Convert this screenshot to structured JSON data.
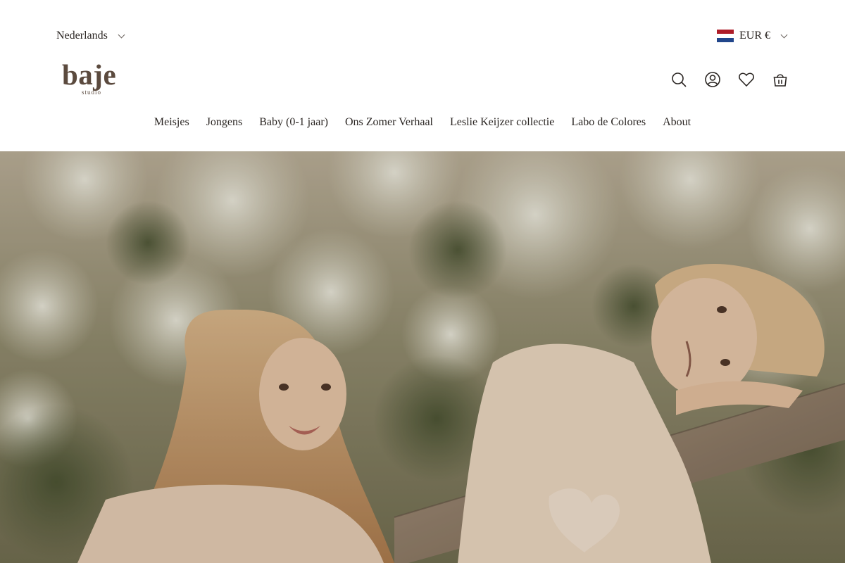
{
  "header": {
    "language": "Nederlands",
    "currency": "EUR €",
    "flag_colors": [
      "#ae1c28",
      "#ffffff",
      "#21468b"
    ],
    "logo": {
      "word": "baje",
      "sub": "studio",
      "color": "#5b4a3e"
    },
    "icons": [
      "search-icon",
      "account-icon",
      "wishlist-heart-icon",
      "cart-bag-icon"
    ]
  },
  "nav": {
    "items": [
      "Meisjes",
      "Jongens",
      "Baby (0-1 jaar)",
      "Ons Zomer Verhaal",
      "Leslie Keijzer collectie",
      "Labo de Colores",
      "About"
    ]
  },
  "hero": {
    "description_colors": {
      "foliage": "#d9d6c6",
      "skin": "#e2c2a6",
      "hair": "#c9a072",
      "dress": "#e8d3bf",
      "wood": "#8c7a66"
    }
  }
}
